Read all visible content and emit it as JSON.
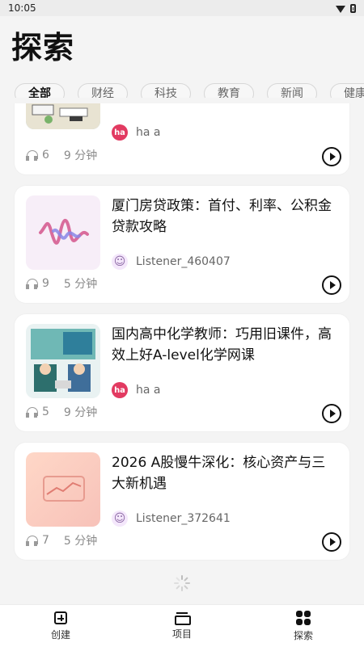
{
  "status_bar": {
    "time": "10:05"
  },
  "header": {
    "title": "探索"
  },
  "categories": [
    {
      "label": "全部",
      "active": true
    },
    {
      "label": "财经"
    },
    {
      "label": "科技"
    },
    {
      "label": "教育"
    },
    {
      "label": "新闻"
    },
    {
      "label": "健康"
    }
  ],
  "cards": [
    {
      "title": "",
      "author": "ha a",
      "listens": "6",
      "duration": "9 分钟",
      "avatar": "ha"
    },
    {
      "title": "厦门房贷政策：首付、利率、公积金贷款攻略",
      "author": "Listener_460407",
      "listens": "9",
      "duration": "5 分钟",
      "avatar": "smile"
    },
    {
      "title": "国内高中化学教师：巧用旧课件，高效上好A-level化学网课",
      "author": "ha a",
      "listens": "5",
      "duration": "9 分钟",
      "avatar": "ha"
    },
    {
      "title": "2026 A股慢牛深化：核心资产与三大新机遇",
      "author": "Listener_372641",
      "listens": "7",
      "duration": "5 分钟",
      "avatar": "smile"
    }
  ],
  "bottom_nav": {
    "create": "创建",
    "projects": "项目",
    "explore": "探索"
  },
  "avatar_text": {
    "ha": "ha",
    "smile": "☺"
  }
}
